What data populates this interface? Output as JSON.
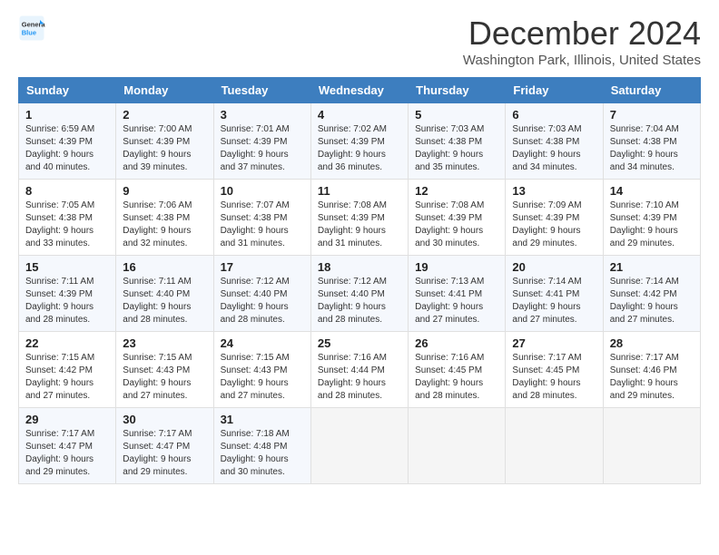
{
  "logo": {
    "line1": "General",
    "line2": "Blue"
  },
  "title": "December 2024",
  "location": "Washington Park, Illinois, United States",
  "days_of_week": [
    "Sunday",
    "Monday",
    "Tuesday",
    "Wednesday",
    "Thursday",
    "Friday",
    "Saturday"
  ],
  "weeks": [
    [
      {
        "day": "1",
        "info": "Sunrise: 6:59 AM\nSunset: 4:39 PM\nDaylight: 9 hours\nand 40 minutes."
      },
      {
        "day": "2",
        "info": "Sunrise: 7:00 AM\nSunset: 4:39 PM\nDaylight: 9 hours\nand 39 minutes."
      },
      {
        "day": "3",
        "info": "Sunrise: 7:01 AM\nSunset: 4:39 PM\nDaylight: 9 hours\nand 37 minutes."
      },
      {
        "day": "4",
        "info": "Sunrise: 7:02 AM\nSunset: 4:39 PM\nDaylight: 9 hours\nand 36 minutes."
      },
      {
        "day": "5",
        "info": "Sunrise: 7:03 AM\nSunset: 4:38 PM\nDaylight: 9 hours\nand 35 minutes."
      },
      {
        "day": "6",
        "info": "Sunrise: 7:03 AM\nSunset: 4:38 PM\nDaylight: 9 hours\nand 34 minutes."
      },
      {
        "day": "7",
        "info": "Sunrise: 7:04 AM\nSunset: 4:38 PM\nDaylight: 9 hours\nand 34 minutes."
      }
    ],
    [
      {
        "day": "8",
        "info": "Sunrise: 7:05 AM\nSunset: 4:38 PM\nDaylight: 9 hours\nand 33 minutes."
      },
      {
        "day": "9",
        "info": "Sunrise: 7:06 AM\nSunset: 4:38 PM\nDaylight: 9 hours\nand 32 minutes."
      },
      {
        "day": "10",
        "info": "Sunrise: 7:07 AM\nSunset: 4:38 PM\nDaylight: 9 hours\nand 31 minutes."
      },
      {
        "day": "11",
        "info": "Sunrise: 7:08 AM\nSunset: 4:39 PM\nDaylight: 9 hours\nand 31 minutes."
      },
      {
        "day": "12",
        "info": "Sunrise: 7:08 AM\nSunset: 4:39 PM\nDaylight: 9 hours\nand 30 minutes."
      },
      {
        "day": "13",
        "info": "Sunrise: 7:09 AM\nSunset: 4:39 PM\nDaylight: 9 hours\nand 29 minutes."
      },
      {
        "day": "14",
        "info": "Sunrise: 7:10 AM\nSunset: 4:39 PM\nDaylight: 9 hours\nand 29 minutes."
      }
    ],
    [
      {
        "day": "15",
        "info": "Sunrise: 7:11 AM\nSunset: 4:39 PM\nDaylight: 9 hours\nand 28 minutes."
      },
      {
        "day": "16",
        "info": "Sunrise: 7:11 AM\nSunset: 4:40 PM\nDaylight: 9 hours\nand 28 minutes."
      },
      {
        "day": "17",
        "info": "Sunrise: 7:12 AM\nSunset: 4:40 PM\nDaylight: 9 hours\nand 28 minutes."
      },
      {
        "day": "18",
        "info": "Sunrise: 7:12 AM\nSunset: 4:40 PM\nDaylight: 9 hours\nand 28 minutes."
      },
      {
        "day": "19",
        "info": "Sunrise: 7:13 AM\nSunset: 4:41 PM\nDaylight: 9 hours\nand 27 minutes."
      },
      {
        "day": "20",
        "info": "Sunrise: 7:14 AM\nSunset: 4:41 PM\nDaylight: 9 hours\nand 27 minutes."
      },
      {
        "day": "21",
        "info": "Sunrise: 7:14 AM\nSunset: 4:42 PM\nDaylight: 9 hours\nand 27 minutes."
      }
    ],
    [
      {
        "day": "22",
        "info": "Sunrise: 7:15 AM\nSunset: 4:42 PM\nDaylight: 9 hours\nand 27 minutes."
      },
      {
        "day": "23",
        "info": "Sunrise: 7:15 AM\nSunset: 4:43 PM\nDaylight: 9 hours\nand 27 minutes."
      },
      {
        "day": "24",
        "info": "Sunrise: 7:15 AM\nSunset: 4:43 PM\nDaylight: 9 hours\nand 27 minutes."
      },
      {
        "day": "25",
        "info": "Sunrise: 7:16 AM\nSunset: 4:44 PM\nDaylight: 9 hours\nand 28 minutes."
      },
      {
        "day": "26",
        "info": "Sunrise: 7:16 AM\nSunset: 4:45 PM\nDaylight: 9 hours\nand 28 minutes."
      },
      {
        "day": "27",
        "info": "Sunrise: 7:17 AM\nSunset: 4:45 PM\nDaylight: 9 hours\nand 28 minutes."
      },
      {
        "day": "28",
        "info": "Sunrise: 7:17 AM\nSunset: 4:46 PM\nDaylight: 9 hours\nand 29 minutes."
      }
    ],
    [
      {
        "day": "29",
        "info": "Sunrise: 7:17 AM\nSunset: 4:47 PM\nDaylight: 9 hours\nand 29 minutes."
      },
      {
        "day": "30",
        "info": "Sunrise: 7:17 AM\nSunset: 4:47 PM\nDaylight: 9 hours\nand 29 minutes."
      },
      {
        "day": "31",
        "info": "Sunrise: 7:18 AM\nSunset: 4:48 PM\nDaylight: 9 hours\nand 30 minutes."
      },
      {
        "day": "",
        "info": ""
      },
      {
        "day": "",
        "info": ""
      },
      {
        "day": "",
        "info": ""
      },
      {
        "day": "",
        "info": ""
      }
    ]
  ]
}
